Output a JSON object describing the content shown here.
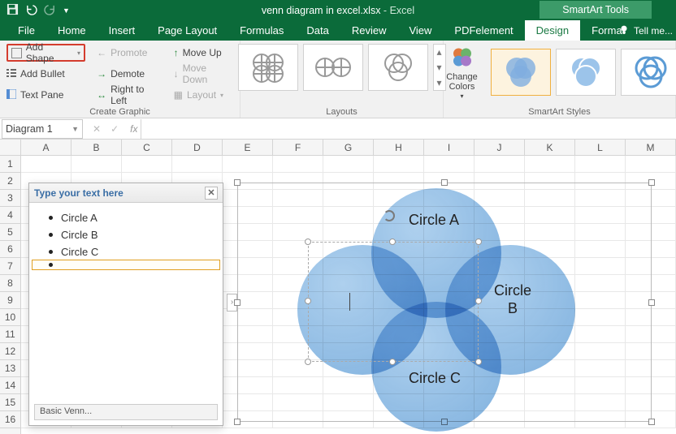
{
  "titlebar": {
    "filename": "venn diagram in excel.xlsx",
    "appname": " - Excel"
  },
  "smartart_tools": "SmartArt Tools",
  "tabs": {
    "file": "File",
    "home": "Home",
    "insert": "Insert",
    "page_layout": "Page Layout",
    "formulas": "Formulas",
    "data": "Data",
    "review": "Review",
    "view": "View",
    "pdfelement": "PDFelement",
    "design": "Design",
    "format": "Format",
    "tellme": "Tell me..."
  },
  "ribbon": {
    "create_graphic": {
      "add_shape": "Add Shape",
      "add_bullet": "Add Bullet",
      "text_pane": "Text Pane",
      "promote": "Promote",
      "demote": "Demote",
      "rtl": "Right to Left",
      "move_up": "Move Up",
      "move_down": "Move Down",
      "layout": "Layout",
      "label": "Create Graphic"
    },
    "layouts_label": "Layouts",
    "change_colors": "Change Colors",
    "styles_label": "SmartArt Styles"
  },
  "namebox": "Diagram 1",
  "fx": "fx",
  "columns": [
    "A",
    "B",
    "C",
    "D",
    "E",
    "F",
    "G",
    "H",
    "I",
    "J",
    "K",
    "L",
    "M"
  ],
  "rows": [
    "1",
    "2",
    "3",
    "4",
    "5",
    "6",
    "7",
    "8",
    "9",
    "10",
    "11",
    "12",
    "13",
    "14",
    "15",
    "16"
  ],
  "text_pane": {
    "title": "Type your text here",
    "items": [
      "Circle A",
      "Circle B",
      "Circle C",
      ""
    ],
    "footer": "Basic Venn..."
  },
  "venn": {
    "a": "Circle A",
    "b": "Circle B",
    "c": "Circle C"
  }
}
